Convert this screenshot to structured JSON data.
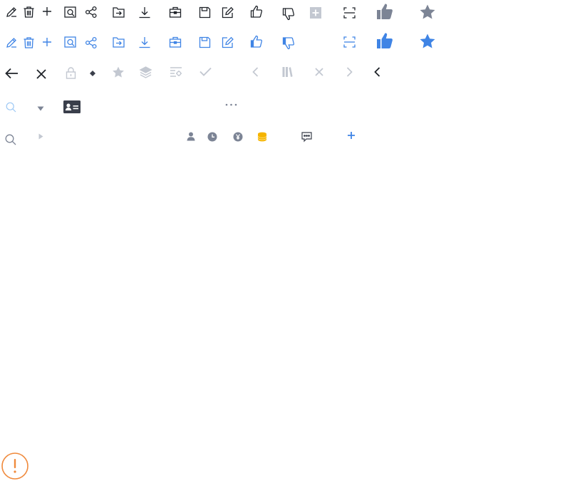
{
  "palette": {
    "icon_default": "#1f2329",
    "icon_active": "#3f84e5",
    "icon_disabled": "#c3c8d1",
    "icon_muted": "#7c8495",
    "icon_dark": "#3a3f4b",
    "icon_search_light": "#9ec9f5",
    "coin": "#f5b400",
    "warning": "#f08a3c"
  },
  "rows": {
    "toolbar_default": [
      "edit-icon",
      "delete-icon",
      "add-icon",
      "preview-icon",
      "share-icon",
      "move-to-folder-icon",
      "download-icon",
      "briefcase-icon",
      "save-icon",
      "edit-note-icon",
      "like-icon",
      "dislike-icon",
      "add-square-icon",
      "scan-icon",
      "like-filled-icon",
      "star-filled-icon"
    ],
    "toolbar_active": [
      "edit-icon",
      "delete-icon",
      "add-icon",
      "preview-icon",
      "share-icon",
      "move-to-folder-icon",
      "download-icon",
      "briefcase-icon",
      "save-icon",
      "edit-note-icon",
      "like-icon",
      "dislike-icon",
      "scan-icon",
      "like-filled-icon",
      "star-filled-icon"
    ],
    "navigation": [
      "back-arrow-icon",
      "close-icon",
      "lock-icon",
      "diamond-icon",
      "star-icon",
      "layers-icon",
      "settings-list-icon",
      "check-icon",
      "chevron-left-icon",
      "library-icon",
      "close-light-icon",
      "chevron-right-icon",
      "chevron-left-dark-icon"
    ],
    "misc_top": [
      "search-light-icon",
      "caret-down-icon",
      "contact-card-icon",
      "more-icon"
    ],
    "misc_bottom": [
      "search-icon",
      "caret-right-icon",
      "user-icon",
      "clock-icon",
      "yuan-icon",
      "coins-icon",
      "comment-icon",
      "plus-blue-icon"
    ],
    "status": [
      "warning-icon"
    ]
  }
}
